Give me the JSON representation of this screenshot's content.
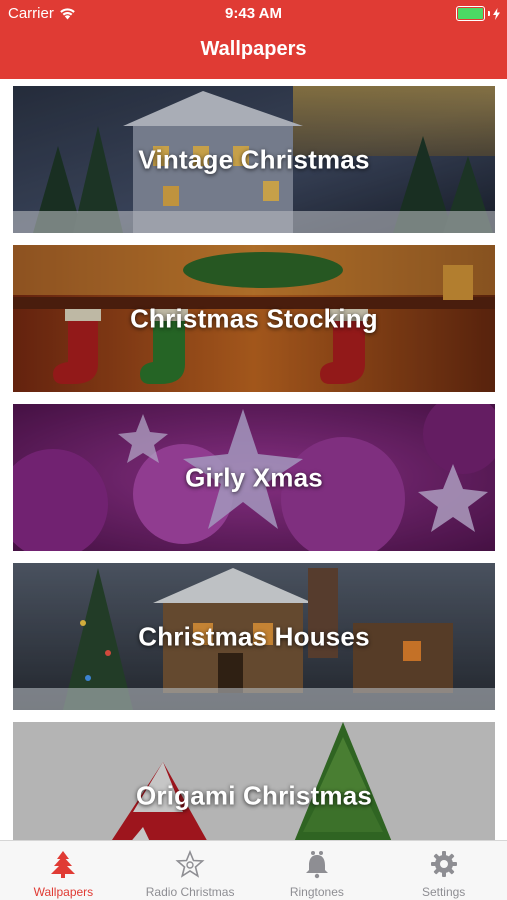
{
  "status_bar": {
    "carrier": "Carrier",
    "time": "9:43 AM",
    "battery_level": 1.0
  },
  "nav": {
    "title": "Wallpapers"
  },
  "categories": [
    {
      "label": "Vintage Christmas"
    },
    {
      "label": "Christmas Stocking"
    },
    {
      "label": "Girly Xmas"
    },
    {
      "label": "Christmas Houses"
    },
    {
      "label": "Origami Christmas"
    }
  ],
  "tabs": [
    {
      "label": "Wallpapers",
      "icon": "tree-icon",
      "active": true
    },
    {
      "label": "Radio Christmas",
      "icon": "star-icon",
      "active": false
    },
    {
      "label": "Ringtones",
      "icon": "bell-icon",
      "active": false
    },
    {
      "label": "Settings",
      "icon": "gear-icon",
      "active": false
    }
  ],
  "colors": {
    "accent": "#e03b34",
    "inactive": "#8e8e93"
  }
}
